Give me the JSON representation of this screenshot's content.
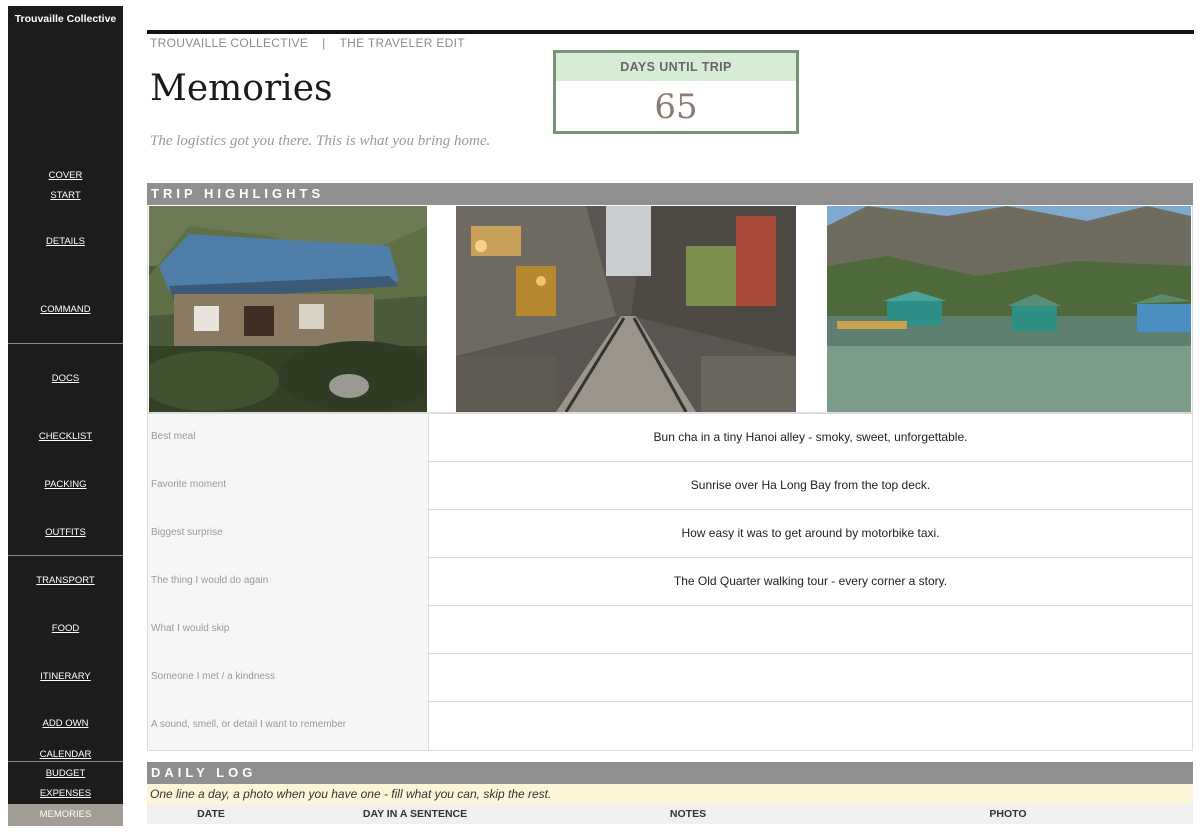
{
  "sidebar": {
    "brand": "Trouvaille Collective",
    "items": [
      {
        "label": "COVER"
      },
      {
        "label": "START"
      },
      {
        "label": "DETAILS"
      },
      {
        "label": "COMMAND"
      },
      {
        "label": "DOCS"
      },
      {
        "label": "CHECKLIST"
      },
      {
        "label": "PACKING"
      },
      {
        "label": "OUTFITS"
      },
      {
        "label": "TRANSPORT"
      },
      {
        "label": "FOOD"
      },
      {
        "label": "ITINERARY"
      },
      {
        "label": "ADD OWN"
      },
      {
        "label": "CALENDAR"
      },
      {
        "label": "BUDGET"
      },
      {
        "label": "EXPENSES"
      },
      {
        "label": "MEMORIES"
      }
    ],
    "active": "MEMORIES"
  },
  "header": {
    "crumb_brand": "TROUVAILLE COLLECTIVE",
    "crumb_sep": "|",
    "crumb_edit": "THE TRAVELER EDIT",
    "title": "Memories",
    "subtitle": "The logistics got you there. This is what you bring home."
  },
  "countdown": {
    "label": "DAYS UNTIL TRIP",
    "value": "65"
  },
  "highlights": {
    "heading": "TRIP HIGHLIGHTS",
    "rows": [
      {
        "label": "Best meal",
        "value": "Bun cha in a tiny Hanoi alley - smoky, sweet, unforgettable."
      },
      {
        "label": "Favorite moment",
        "value": "Sunrise over Ha Long Bay from the top deck."
      },
      {
        "label": "Biggest surprise",
        "value": "How easy it was to get around by motorbike taxi."
      },
      {
        "label": "The thing I would do again",
        "value": "The Old Quarter walking tour - every corner a story."
      },
      {
        "label": "What I would skip",
        "value": ""
      },
      {
        "label": "Someone I met / a kindness",
        "value": ""
      },
      {
        "label": "A sound, smell, or detail I want to remember",
        "value": ""
      }
    ]
  },
  "daily_log": {
    "heading": "DAILY LOG",
    "hint": "One line a day, a photo when you have one - fill what you can, skip the rest.",
    "columns": [
      "DATE",
      "DAY IN A SENTENCE",
      "NOTES",
      "PHOTO"
    ]
  },
  "colors": {
    "sidebar_bg": "#1c1c1c",
    "active_item": "#a39e95",
    "section_bar": "#8f8f8f",
    "countdown_border": "#7a9277",
    "countdown_label_bg": "#d7ecd4",
    "hint_bg": "#fdf5d8"
  }
}
